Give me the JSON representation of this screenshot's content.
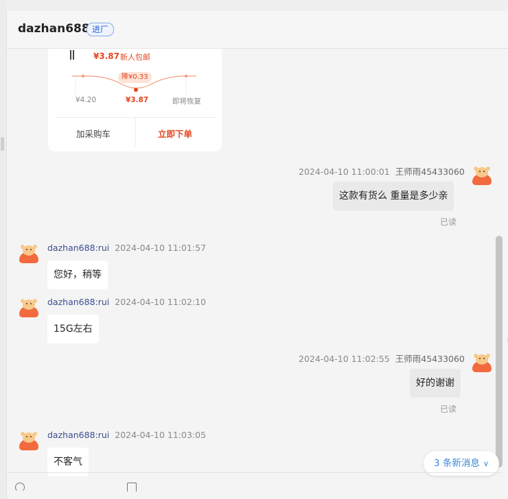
{
  "header": {
    "name": "dazhan688",
    "tag": "进厂"
  },
  "product_card": {
    "price": "¥3.87",
    "promo": "新人包邮",
    "drop_badge": "降¥0.33",
    "price_labels": {
      "original": "¥4.20",
      "current": "¥3.87",
      "restore": "即将恢复"
    },
    "add_to_cart": "加采购车",
    "buy_now": "立即下单"
  },
  "messages": [
    {
      "id": "m1",
      "direction": "out",
      "time": "2024-04-10 11:00:01",
      "sender": "王师雨45433060",
      "text": "这款有货么 重量是多少亲",
      "status": "已读"
    },
    {
      "id": "m2",
      "direction": "in",
      "time": "2024-04-10 11:01:57",
      "sender": "dazhan688:rui",
      "text": "您好，稍等"
    },
    {
      "id": "m3",
      "direction": "in",
      "time": "2024-04-10 11:02:10",
      "sender": "dazhan688:rui",
      "text": "15G左右"
    },
    {
      "id": "m4",
      "direction": "out",
      "time": "2024-04-10 11:02:55",
      "sender": "王师雨45433060",
      "text": "好的谢谢",
      "status": "已读"
    },
    {
      "id": "m5",
      "direction": "in",
      "time": "2024-04-10 11:03:05",
      "sender": "dazhan688:rui",
      "text": "不客气"
    }
  ],
  "new_messages": {
    "label": "3 条新消息"
  },
  "icons": {
    "avatar": "cow-avatar-icon",
    "scroll_down": "chevron-down-icon",
    "side_collapse": "chevron-right-icon"
  }
}
